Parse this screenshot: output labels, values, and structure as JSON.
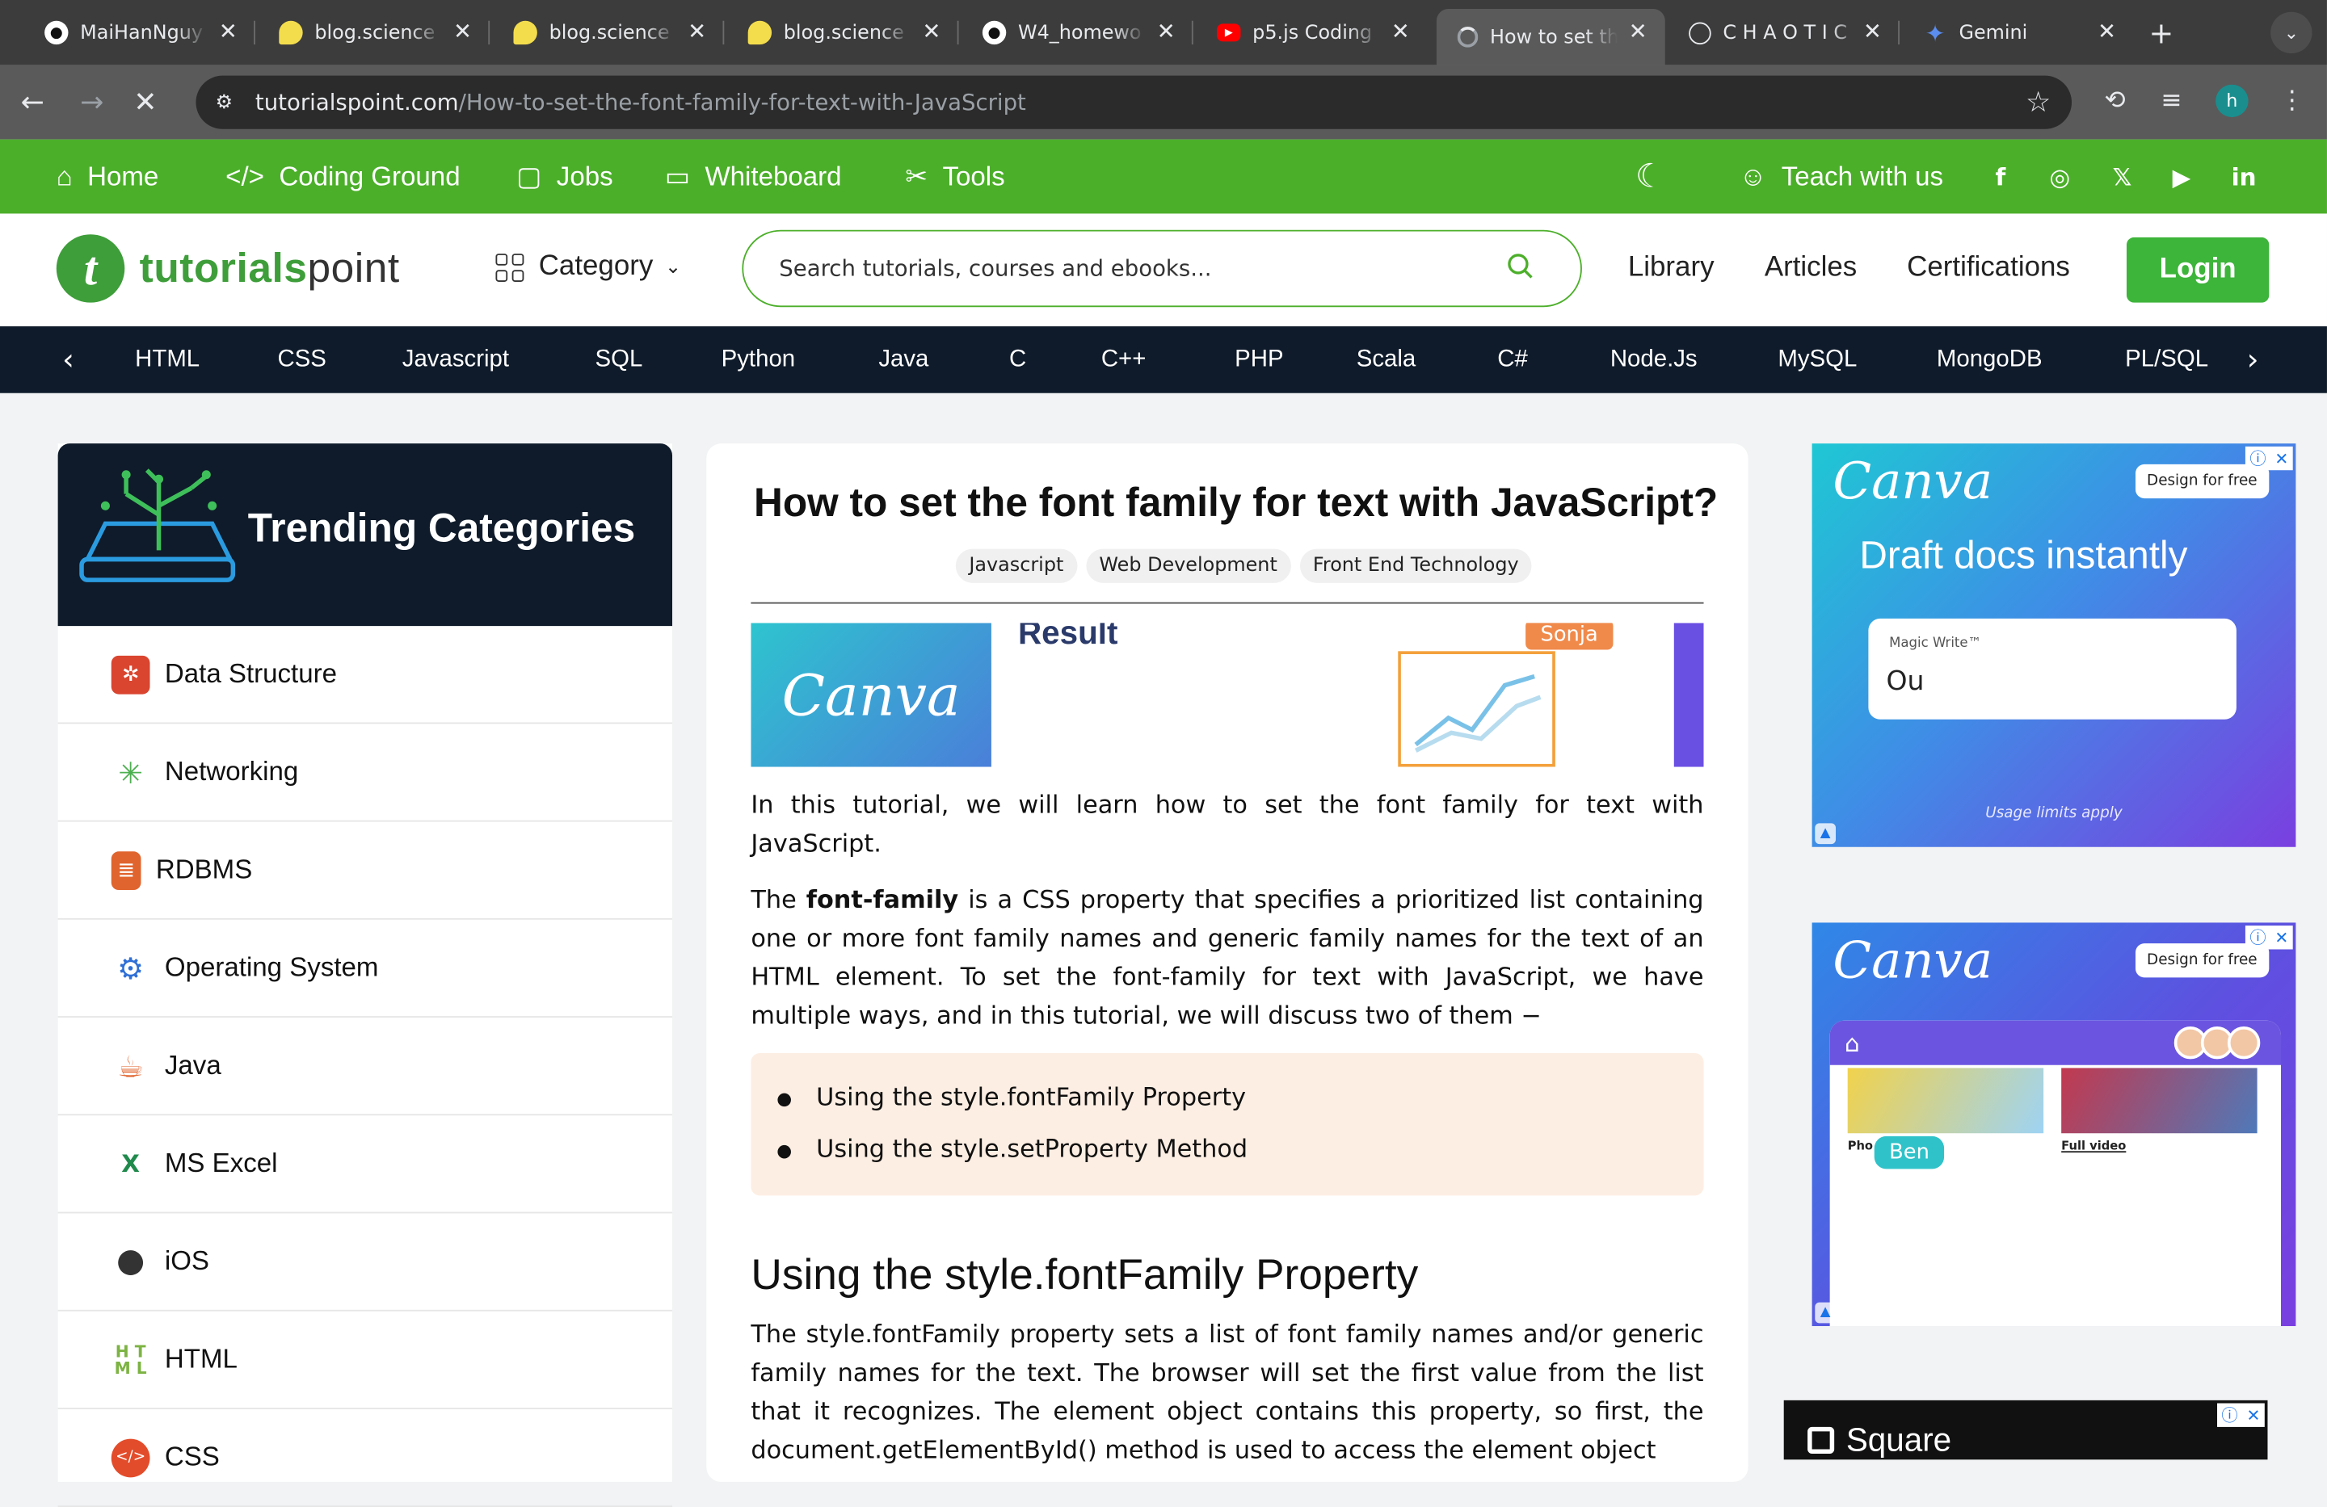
{
  "browser": {
    "tabs": [
      {
        "title": "MaiHanNguy",
        "icon": "github-icon"
      },
      {
        "title": "blog.science",
        "icon": "lemon-icon"
      },
      {
        "title": "blog.science",
        "icon": "lemon-icon"
      },
      {
        "title": "blog.science",
        "icon": "lemon-icon"
      },
      {
        "title": "W4_homewo",
        "icon": "github-icon"
      },
      {
        "title": "p5.js Coding",
        "icon": "youtube-icon"
      },
      {
        "title": "How to set th",
        "icon": "loading-icon",
        "active": true
      },
      {
        "title": "C H A O T I C",
        "icon": "globe-icon"
      },
      {
        "title": "Gemini",
        "icon": "gemini-icon"
      }
    ],
    "url_domain": "tutorialspoint.com",
    "url_path": "/How-to-set-the-font-family-for-text-with-JavaScript",
    "profile_initial": "h"
  },
  "topnav": {
    "items": [
      "Home",
      "Coding Ground",
      "Jobs",
      "Whiteboard",
      "Tools"
    ],
    "teach": "Teach with us"
  },
  "header": {
    "logo_part1": "tutorials",
    "logo_part2": "point",
    "category": "Category",
    "search_placeholder": "Search tutorials, courses and ebooks...",
    "links": [
      "Library",
      "Articles",
      "Certifications"
    ],
    "login": "Login"
  },
  "langbar": [
    "HTML",
    "CSS",
    "Javascript",
    "SQL",
    "Python",
    "Java",
    "C",
    "C++",
    "PHP",
    "Scala",
    "C#",
    "Node.Js",
    "MySQL",
    "MongoDB",
    "PL/SQL"
  ],
  "sidebar": {
    "title": "Trending Categories",
    "items": [
      "Data Structure",
      "Networking",
      "RDBMS",
      "Operating System",
      "Java",
      "MS Excel",
      "iOS",
      "HTML",
      "CSS"
    ]
  },
  "article": {
    "title": "How to set the font family for text with JavaScript?",
    "tags": [
      "Javascript",
      "Web Development",
      "Front End Technology"
    ],
    "intro": "In this tutorial, we will learn how to set the font family for text with JavaScript.",
    "p2_before": "The ",
    "p2_bold": "font-family",
    "p2_after": " is a CSS property that specifies a prioritized list containing one or more font family names and generic family names for the text of an HTML element. To set the font-family for text with JavaScript, we have multiple ways, and in this tutorial, we will discuss two of them −",
    "bullets": [
      "Using the style.fontFamily Property",
      "Using the style.setProperty Method"
    ],
    "h2": "Using the style.fontFamily Property",
    "p3": "The style.fontFamily property sets a list of font family names and/or generic family names for the text. The browser will set the first value from the list that it recognizes. The element object contains this property, so first, the document.getElementById() method is used to access the element object"
  },
  "inline_ad": {
    "brand": "Canva",
    "result": "Result",
    "name": "Sonja"
  },
  "ads": {
    "ad1": {
      "brand": "Canva",
      "badge": "Design for free",
      "headline": "Draft docs instantly",
      "card_label": "Magic Write™",
      "card_text": "Ou",
      "footnote": "Usage limits apply"
    },
    "ad2": {
      "brand": "Canva",
      "badge": "Design for free",
      "cap1": "Pho",
      "cap2": "Full video",
      "bubble": "Ben"
    },
    "ad3": {
      "brand": "Square"
    }
  }
}
